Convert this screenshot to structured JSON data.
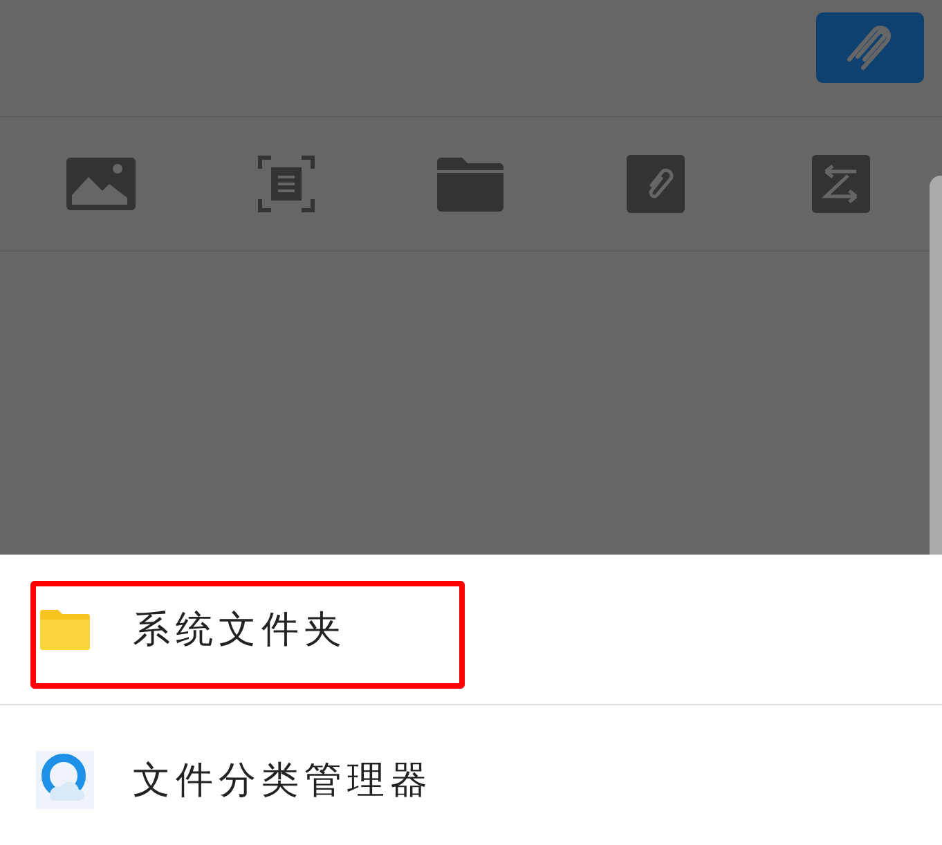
{
  "toolbar": {
    "tools": [
      {
        "kind": "image"
      },
      {
        "kind": "scan"
      },
      {
        "kind": "folder"
      },
      {
        "kind": "attachment"
      },
      {
        "kind": "transfer"
      }
    ]
  },
  "bottom_sheet": {
    "items": [
      {
        "kind": "folder",
        "label": "系统文件夹",
        "highlighted": true
      },
      {
        "kind": "file-manager",
        "label": "文件分类管理器",
        "highlighted": false
      }
    ]
  }
}
